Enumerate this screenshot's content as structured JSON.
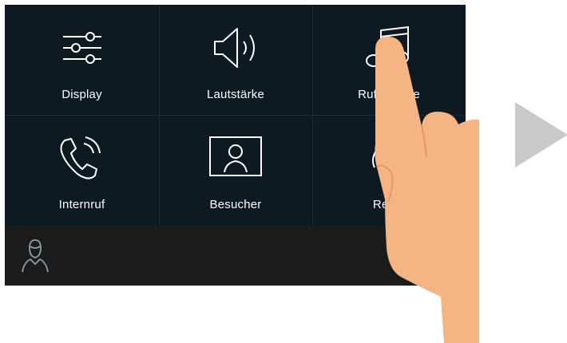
{
  "tiles": [
    {
      "label": "Display",
      "icon": "sliders-icon"
    },
    {
      "label": "Lautstärke",
      "icon": "speaker-volume-icon"
    },
    {
      "label": "Rufmelodie",
      "icon": "music-note-icon"
    },
    {
      "label": "Internruf",
      "icon": "phone-ringing-icon"
    },
    {
      "label": "Besucher",
      "icon": "visitor-picture-icon"
    },
    {
      "label": "Reset",
      "icon": "reset-icon"
    }
  ],
  "bottombar": {
    "icon": "user-icon"
  },
  "navigation": {
    "icon": "play-arrow-icon"
  },
  "colors": {
    "screen": "#0d1a22",
    "bar": "#1c1c1c",
    "text": "#ffffff",
    "arrow": "#c9c9c9",
    "hand": "#f4b483"
  }
}
